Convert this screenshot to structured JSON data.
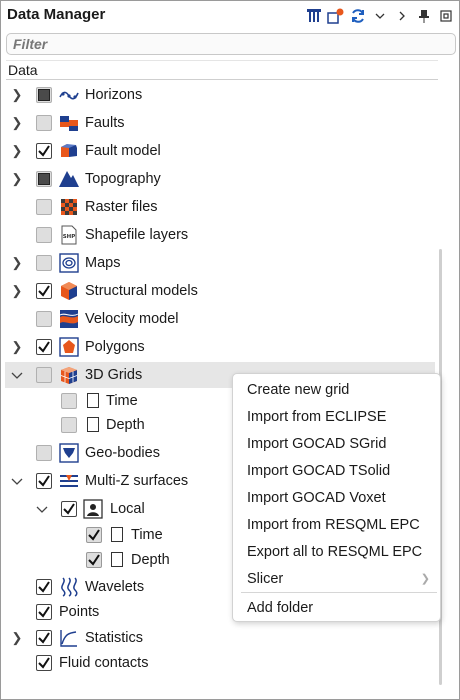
{
  "panel": {
    "title": "Data Manager",
    "filter_placeholder": "Filter",
    "column_header": "Data"
  },
  "toolbar": {
    "icons": [
      "filter-tree-icon",
      "settings-badge-icon",
      "refresh-icon",
      "chevron-down-icon",
      "chevron-right-icon",
      "pin-icon",
      "maximize-icon"
    ]
  },
  "tree": {
    "horizons": "Horizons",
    "faults": "Faults",
    "fault_model": "Fault model",
    "topography": "Topography",
    "raster_files": "Raster files",
    "shapefile_layers": "Shapefile layers",
    "shp_badge": "SHP",
    "maps": "Maps",
    "structural_models": "Structural models",
    "velocity_model": "Velocity model",
    "polygons": "Polygons",
    "grids_3d": "3D Grids",
    "grids_time": "Time",
    "grids_depth": "Depth",
    "geo_bodies": "Geo-bodies",
    "multi_z": "Multi-Z surfaces",
    "local": "Local",
    "local_time": "Time",
    "local_depth": "Depth",
    "wavelets": "Wavelets",
    "points": "Points",
    "statistics": "Statistics",
    "fluid_contacts": "Fluid contacts"
  },
  "context_menu": {
    "create_new_grid": "Create new grid",
    "import_eclipse": "Import from ECLIPSE",
    "import_gocad_sgrid": "Import GOCAD SGrid",
    "import_gocad_tsolid": "Import GOCAD TSolid",
    "import_gocad_voxet": "Import GOCAD Voxet",
    "import_resqml": "Import from RESQML EPC",
    "export_resqml": "Export all to RESQML EPC",
    "slicer": "Slicer",
    "add_folder": "Add folder"
  }
}
